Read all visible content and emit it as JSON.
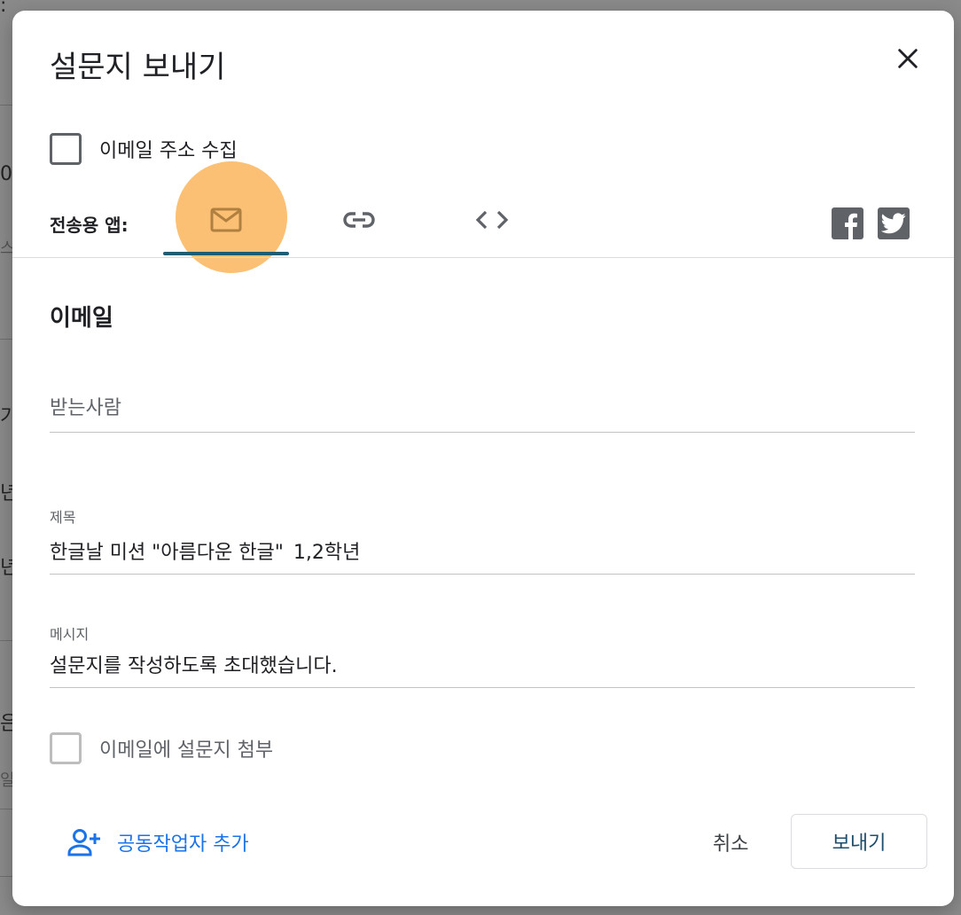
{
  "dialog": {
    "title": "설문지 보내기",
    "close_icon": "close-icon"
  },
  "collect_email": {
    "label": "이메일 주소 수집",
    "checked": false
  },
  "send_via": {
    "label": "전송용 앱:",
    "tabs": [
      {
        "icon": "mail-icon",
        "selected": true
      },
      {
        "icon": "link-icon",
        "selected": false
      },
      {
        "icon": "embed-code-icon",
        "selected": false
      }
    ],
    "social": [
      {
        "icon": "facebook-icon"
      },
      {
        "icon": "twitter-icon"
      }
    ]
  },
  "email_section": {
    "title": "이메일",
    "to": {
      "placeholder": "받는사람",
      "value": ""
    },
    "subject": {
      "label": "제목",
      "value": "한글날 미션 \"아름다운 한글\"_1,2학년"
    },
    "message": {
      "label": "메시지",
      "value": "설문지를 작성하도록 초대했습니다."
    },
    "attach": {
      "label": "이메일에 설문지 첨부",
      "checked": false
    }
  },
  "footer": {
    "add_collaborators": "공동작업자 추가",
    "cancel": "취소",
    "send": "보내기"
  },
  "colors": {
    "accent_blue": "#1a73e8",
    "tab_underline": "#1e5d72",
    "highlight": "#fbbd6b"
  }
}
